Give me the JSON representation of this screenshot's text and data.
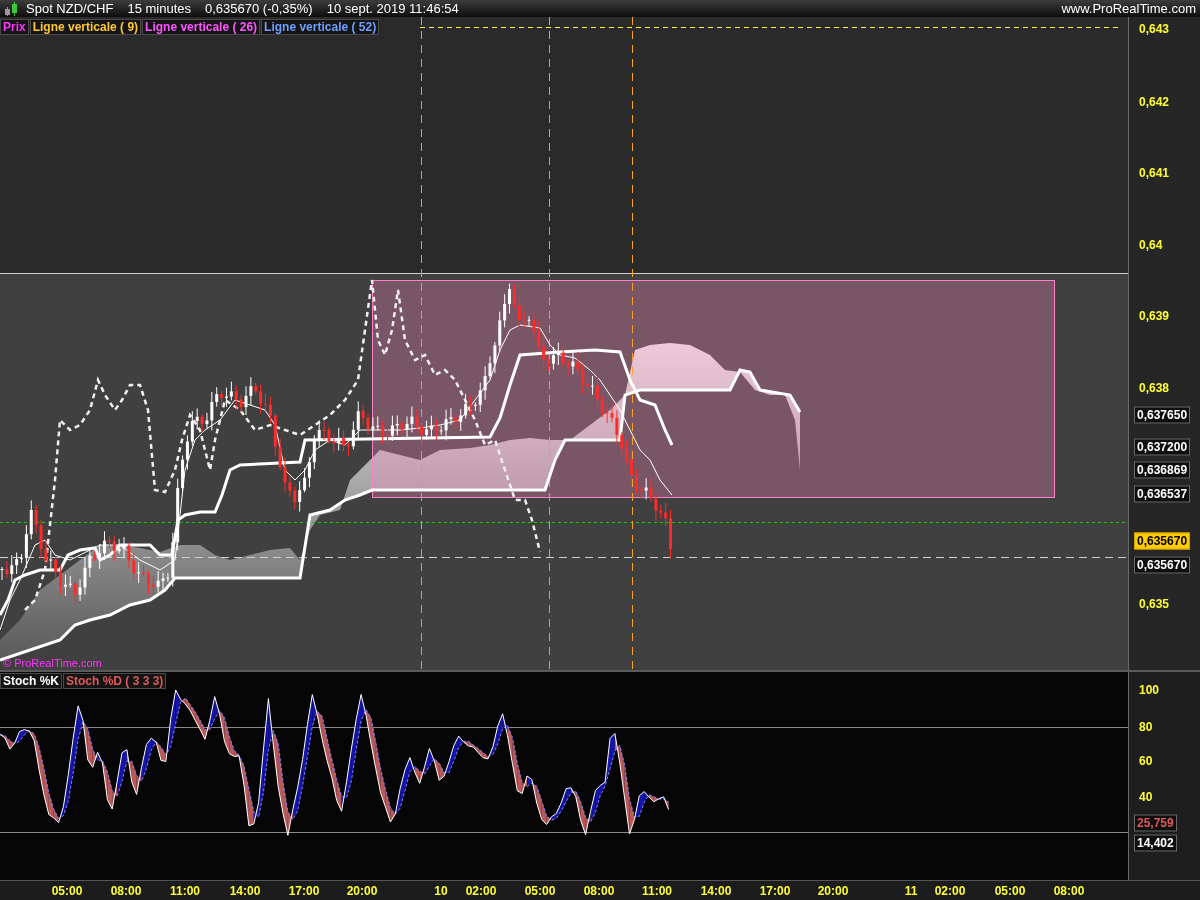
{
  "title_bar": {
    "instrument": "Spot NZD/CHF",
    "interval": "15 minutes",
    "last_price": "0,635670 (-0,35%)",
    "timestamp": "10 sept. 2019 11:46:54",
    "website": "www.ProRealTime.com"
  },
  "price_panel": {
    "legend": [
      {
        "label": "Prix",
        "color": "#ff33ff"
      },
      {
        "label": "Ligne verticale ( 9)",
        "color": "#ffc832"
      },
      {
        "label": "Ligne verticale ( 26)",
        "color": "#ff55ff"
      },
      {
        "label": "Ligne verticale ( 52)",
        "color": "#6f9fff"
      }
    ],
    "copyright": "© ProRealTime.com",
    "axis_ticks": [
      "0,643",
      "0,642",
      "0,641",
      "0,64",
      "0,639",
      "0,638",
      "0,635"
    ],
    "price_tags": [
      {
        "label": "0,637650",
        "kind": "line"
      },
      {
        "label": "0,637200",
        "kind": "line"
      },
      {
        "label": "0,636869",
        "kind": "line"
      },
      {
        "label": "0,636537",
        "kind": "line"
      },
      {
        "label": "0,635670",
        "kind": "current"
      },
      {
        "label": "0,635670",
        "kind": "line"
      }
    ]
  },
  "stochastic_panel": {
    "legend": [
      {
        "label": "Stoch %K",
        "color": "#ffffff"
      },
      {
        "label": "Stoch %D ( 3 3 3)",
        "color": "#e05a5a"
      }
    ],
    "axis_ticks": [
      "100",
      "80",
      "60",
      "40"
    ],
    "value_tags": [
      {
        "label": "25,759",
        "color": "#e05a5a"
      },
      {
        "label": "14,402",
        "color": "#ffffff"
      }
    ]
  },
  "time_axis": {
    "labels": [
      "05:00",
      "08:00",
      "11:00",
      "14:00",
      "17:00",
      "20:00",
      "10",
      "02:00",
      "05:00",
      "08:00",
      "11:00",
      "14:00",
      "17:00",
      "20:00",
      "11",
      "02:00",
      "05:00",
      "08:00"
    ]
  }
}
